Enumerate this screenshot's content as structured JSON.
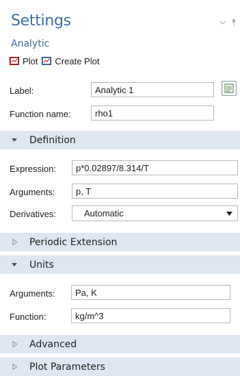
{
  "header": {
    "title": "Settings",
    "subtitle": "Analytic"
  },
  "toolbar": {
    "plot_label": "Plot",
    "create_plot_label": "Create Plot"
  },
  "general": {
    "label_caption": "Label:",
    "label_value": "Analytic 1",
    "function_name_caption": "Function name:",
    "function_name_value": "rho1"
  },
  "definition": {
    "title": "Definition",
    "expression_caption": "Expression:",
    "expression_value": "p*0.02897/8.314/T",
    "arguments_caption": "Arguments:",
    "arguments_value": "p, T",
    "derivatives_caption": "Derivatives:",
    "derivatives_value": "Automatic"
  },
  "periodic": {
    "title": "Periodic Extension"
  },
  "units": {
    "title": "Units",
    "arguments_caption": "Arguments:",
    "arguments_value": "Pa, K",
    "function_caption": "Function:",
    "function_value": "kg/m^3"
  },
  "advanced": {
    "title": "Advanced"
  },
  "plot_parameters": {
    "title": "Plot Parameters"
  },
  "icons": {
    "plot": "plot-icon",
    "create_plot": "create-plot-icon",
    "edit": "edit-expression-icon",
    "expanded": "triangle-down-icon",
    "collapsed": "triangle-right-icon"
  },
  "colors": {
    "title": "#3f6ea7",
    "section_bg": "#dee7f1",
    "field_border": "#b8b8b8"
  }
}
